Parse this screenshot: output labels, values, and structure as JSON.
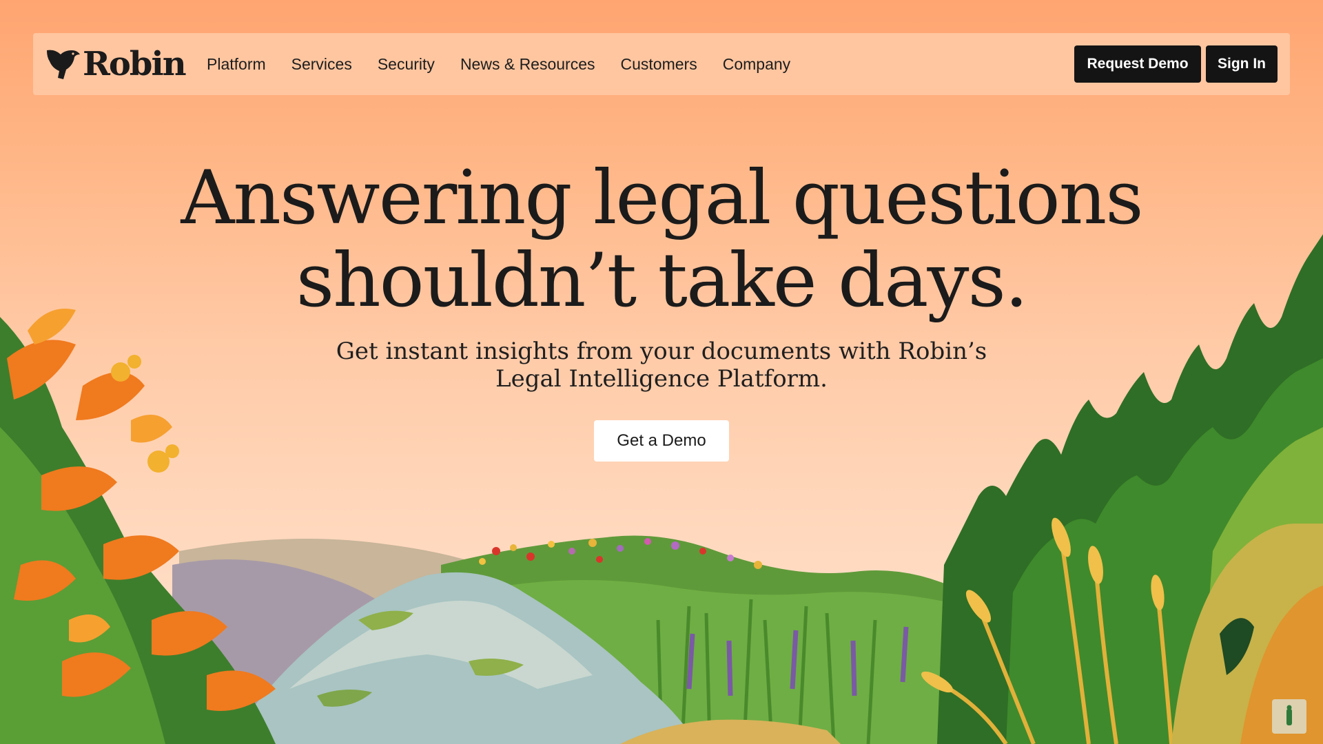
{
  "brand": {
    "name": "Robin",
    "icon": "bird-icon"
  },
  "nav": {
    "items": [
      {
        "label": "Platform"
      },
      {
        "label": "Services"
      },
      {
        "label": "Security"
      },
      {
        "label": "News & Resources"
      },
      {
        "label": "Customers"
      },
      {
        "label": "Company"
      }
    ],
    "request_demo_label": "Request Demo",
    "sign_in_label": "Sign In"
  },
  "hero": {
    "headline_line1": "Answering legal questions",
    "headline_line2": "shouldn’t take days.",
    "subhead_line1": "Get instant insights from your documents with Robin’s",
    "subhead_line2": "Legal Intelligence Platform.",
    "cta_label": "Get a Demo"
  },
  "colors": {
    "background_top": "#ffa571",
    "background_bottom": "#ffdcc4",
    "nav_background": "#ffc6a0",
    "dark_button": "#141414",
    "text": "#1b1b1b"
  },
  "illustration": {
    "subject": "landscape-illustration-icon"
  },
  "corner_widget": {
    "icon": "accessibility-icon"
  }
}
